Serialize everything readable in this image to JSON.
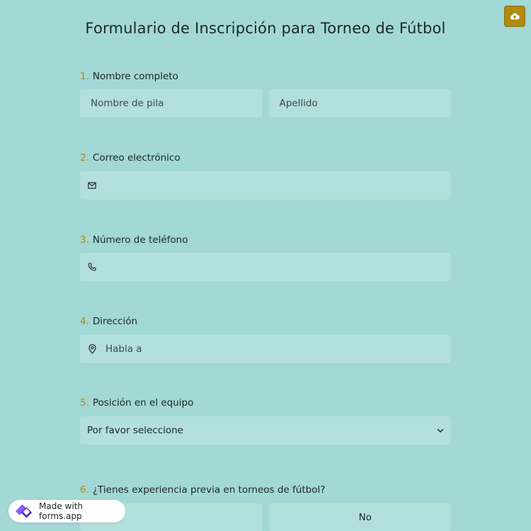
{
  "title": "Formulario de Inscripción para Torneo de Fútbol",
  "questions": [
    {
      "num": "1.",
      "label": "Nombre completo",
      "first_placeholder": "Nombre de pila",
      "last_placeholder": "Apellido"
    },
    {
      "num": "2.",
      "label": "Correo electrónico",
      "value": ""
    },
    {
      "num": "3.",
      "label": "Número de teléfono",
      "value": ""
    },
    {
      "num": "4.",
      "label": "Dirección",
      "placeholder": "Habla a"
    },
    {
      "num": "5.",
      "label": "Posición en el equipo",
      "selected": "Por favor seleccione"
    },
    {
      "num": "6.",
      "label": "¿Tienes experiencia previa en torneos de fútbol?",
      "options": [
        "",
        "No"
      ]
    }
  ],
  "badge": {
    "text": "Made with forms.app"
  },
  "icons": {
    "save": "cloud-upload-icon",
    "email": "envelope-icon",
    "phone": "phone-icon",
    "address": "map-pin-icon",
    "select": "chevron-down-icon",
    "brand": "forms-app-logo-icon"
  },
  "colors": {
    "background": "#a2d8d5",
    "field": "#b3dfdd",
    "accent": "#b08a12"
  }
}
